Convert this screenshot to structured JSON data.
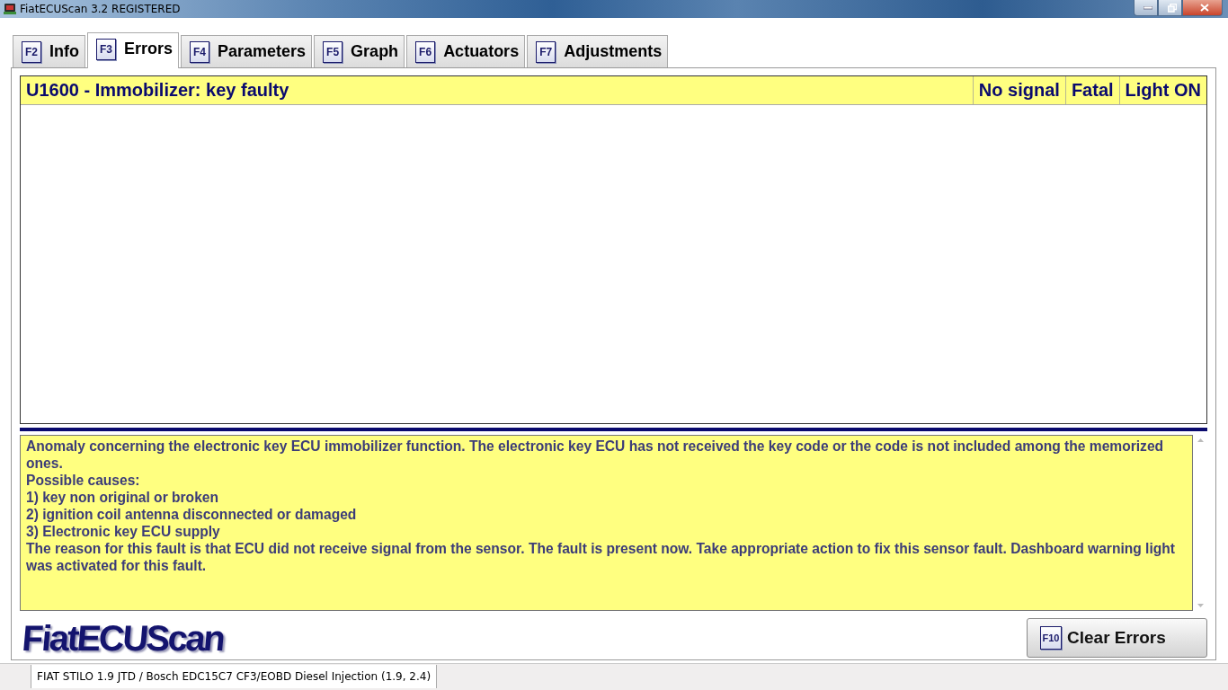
{
  "window": {
    "title": "FiatECUScan 3.2 REGISTERED"
  },
  "tabs": [
    {
      "key": "F2",
      "label": "Info",
      "selected": false
    },
    {
      "key": "F3",
      "label": "Errors",
      "selected": true
    },
    {
      "key": "F4",
      "label": "Parameters",
      "selected": false
    },
    {
      "key": "F5",
      "label": "Graph",
      "selected": false
    },
    {
      "key": "F6",
      "label": "Actuators",
      "selected": false
    },
    {
      "key": "F7",
      "label": "Adjustments",
      "selected": false
    }
  ],
  "errors": [
    {
      "description": "U1600 - Immobilizer: key faulty",
      "status": "No signal",
      "severity": "Fatal",
      "lamp": "Light ON",
      "selected": true
    }
  ],
  "details": [
    "Anomaly concerning the electronic key ECU immobilizer function. The electronic key ECU has not received the key code or the code is not included among the memorized ones.",
    "Possible causes:",
    "1) key non original or broken",
    "2) ignition coil antenna disconnected or damaged",
    "3) Electronic key ECU supply",
    "The reason for this fault is that ECU did not receive signal from the sensor. The fault is present now. Take appropriate action to fix this sensor fault. Dashboard warning light was activated for this fault."
  ],
  "logo": "FiatECUScan",
  "clear_button": {
    "key": "F10",
    "label": "Clear Errors"
  },
  "status_bar": [
    "FIAT STILO 1.9 JTD / Bosch EDC15C7 CF3/EOBD Diesel Injection (1.9, 2.4)"
  ]
}
